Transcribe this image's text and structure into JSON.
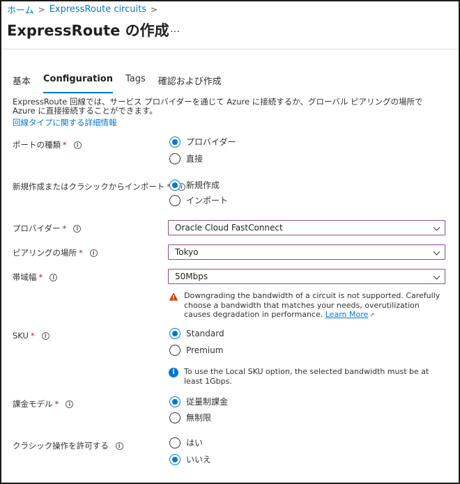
{
  "breadcrumb": {
    "home": "ホーム",
    "circuits": "ExpressRoute circuits"
  },
  "page": {
    "title": "ExpressRoute の作成",
    "more": "…"
  },
  "tabs": [
    "基本",
    "Configuration",
    "Tags",
    "確認および作成"
  ],
  "description": {
    "text": "ExpressRoute 回線では、サービス プロバイダーを通じて Azure に接続するか、グローバル ピアリングの場所で Azure に直接接続することができます。",
    "link": "回線タイプに関する詳細情報"
  },
  "fields": {
    "port_type": {
      "label": "ポートの種類",
      "options": [
        "プロバイダー",
        "直接"
      ],
      "selected": 0
    },
    "create_or_import": {
      "label": "新規作成またはクラシックからインポート",
      "options": [
        "新規作成",
        "インポート"
      ],
      "selected": 0
    },
    "provider": {
      "label": "プロバイダー",
      "value": "Oracle Cloud FastConnect"
    },
    "peering_location": {
      "label": "ピアリングの場所",
      "value": "Tokyo"
    },
    "bandwidth": {
      "label": "帯域幅",
      "value": "50Mbps",
      "warning": "Downgrading the bandwidth of a circuit is not supported. Carefully choose a bandwidth that matches your needs, overutilization causes degradation in performance.",
      "learn_more": "Learn More"
    },
    "sku": {
      "label": "SKU",
      "options": [
        "Standard",
        "Premium"
      ],
      "selected": 0,
      "info": "To use the Local SKU option, the selected bandwidth must be at least 1Gbps."
    },
    "billing_model": {
      "label": "課金モデル",
      "options": [
        "従量制課金",
        "無制限"
      ],
      "selected": 0
    },
    "allow_classic": {
      "label": "クラシック操作を許可する",
      "options": [
        "はい",
        "いいえ"
      ],
      "selected": 1
    }
  },
  "required_mark": "*",
  "info_glyph": "i",
  "colors": {
    "accent": "#0078d4",
    "warning": "#d83b01",
    "required": "#a4262c",
    "select_border": "#8a4d89"
  }
}
